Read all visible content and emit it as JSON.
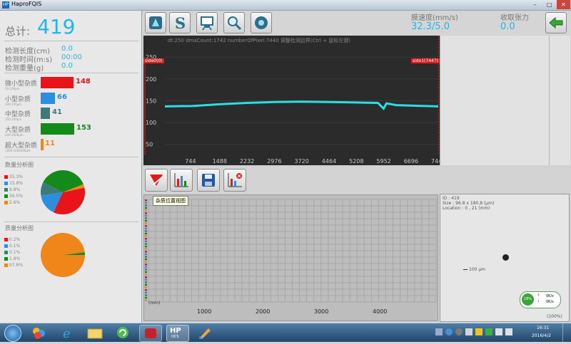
{
  "window": {
    "title": "HaproFQIS",
    "app_icon": "HP"
  },
  "left": {
    "total_label": "总计:",
    "total_value": "419",
    "length_label": "检测长度(cm)",
    "length_value": "0.0",
    "time_label": "检测时间(m:s)",
    "time_value": "00:00",
    "weight_label": "检测重量(g)",
    "weight_value": "0.0",
    "categories": [
      {
        "label": "微小型杂质",
        "sub": "50-100μm",
        "value": "148",
        "count": 148,
        "color": "#e8141a"
      },
      {
        "label": "小型杂质",
        "sub": "100-150μm",
        "value": "66",
        "count": 66,
        "color": "#2c8ede"
      },
      {
        "label": "中型杂质",
        "sub": "150-200μm",
        "value": "41",
        "count": 41,
        "color": "#3d7b7b"
      },
      {
        "label": "大型杂质",
        "sub": "200-1000μm",
        "value": "153",
        "count": 153,
        "color": "#138a1a"
      },
      {
        "label": "超大型杂质",
        "sub": "1000-1000000μm",
        "value": "11",
        "count": 11,
        "color": "#f08519"
      }
    ],
    "count_chart_title": "数量分析图",
    "count_legend": [
      "35.3%",
      "15.8%",
      "9.8%",
      "36.5%",
      "2.6%"
    ],
    "count_pcts": [
      35.3,
      15.8,
      9.8,
      36.5,
      2.6
    ],
    "mass_chart_title": "质量分析图",
    "mass_legend": [
      "0.2%",
      "0.1%",
      "0.1%",
      "1.8%",
      "97.8%"
    ],
    "mass_pcts": [
      0.2,
      0.1,
      0.1,
      1.8,
      97.8
    ]
  },
  "toolbar_top": {
    "icons": [
      "sensor-icon",
      "s-logo-icon",
      "monitor-icon",
      "magnifier-icon",
      "gear-dot-icon"
    ]
  },
  "header": {
    "speed_label": "膜速度(mm/s)",
    "speed_value": "32.3/5.0",
    "tension_label": "收取张力",
    "tension_value": "0.0",
    "export_icon": "export-arrow-icon"
  },
  "chart_data": {
    "type": "line",
    "info_text": "dt:250   dmaCount:1742   numberOfPixel:7440   调整检测边界(Ctrl + 鼠标左键)",
    "y_ticks": [
      "250",
      "200",
      "150",
      "100",
      "50"
    ],
    "x_ticks": [
      "744",
      "1488",
      "2232",
      "2976",
      "3720",
      "4464",
      "5208",
      "5952",
      "6696",
      "7440"
    ],
    "ylim": [
      25,
      270
    ],
    "xlim": [
      0,
      7440
    ],
    "left_marker": "side0(0)",
    "right_marker": "side1(7447)",
    "series": [
      {
        "values": [
          [
            0,
            137
          ],
          [
            744,
            138
          ],
          [
            1488,
            142
          ],
          [
            2232,
            145
          ],
          [
            2976,
            147
          ],
          [
            3720,
            148
          ],
          [
            4464,
            147
          ],
          [
            5208,
            146
          ],
          [
            5800,
            145
          ],
          [
            5952,
            132
          ],
          [
            6030,
            144
          ],
          [
            6300,
            140
          ],
          [
            6696,
            139
          ],
          [
            7440,
            137
          ]
        ],
        "color": "#27e0e6"
      }
    ]
  },
  "toolbar_bottom": {
    "icons": [
      "marker-arrow-icon",
      "bar-chart-icon",
      "save-icon",
      "chart-delete-icon"
    ],
    "tooltip": "杂质位置视图"
  },
  "grid": {
    "x_ticks": [
      "1000",
      "2000",
      "3000",
      "4000"
    ],
    "unit_label": "(mm)"
  },
  "detail": {
    "id_line": "ID : 419",
    "size_line": "Size : 96.8 x 180.8 (μm)",
    "location_line": "Location : 0 , 21 (mm)",
    "scale_label": "100 μm",
    "gauge_pct": "18%",
    "rate_up": "0K/s",
    "rate_down": "0K/s",
    "zoom_label": "(100%)"
  },
  "taskbar": {
    "time": "16:31",
    "date": "2016/4/2",
    "items": [
      "start-button",
      "paint-icon",
      "ie-icon",
      "explorer-icon",
      "refresh-app-icon",
      "red-app-icon",
      "hp-app-icon",
      "brush-app-icon"
    ],
    "hp_label": "HP",
    "hp_sub": "OCS"
  }
}
